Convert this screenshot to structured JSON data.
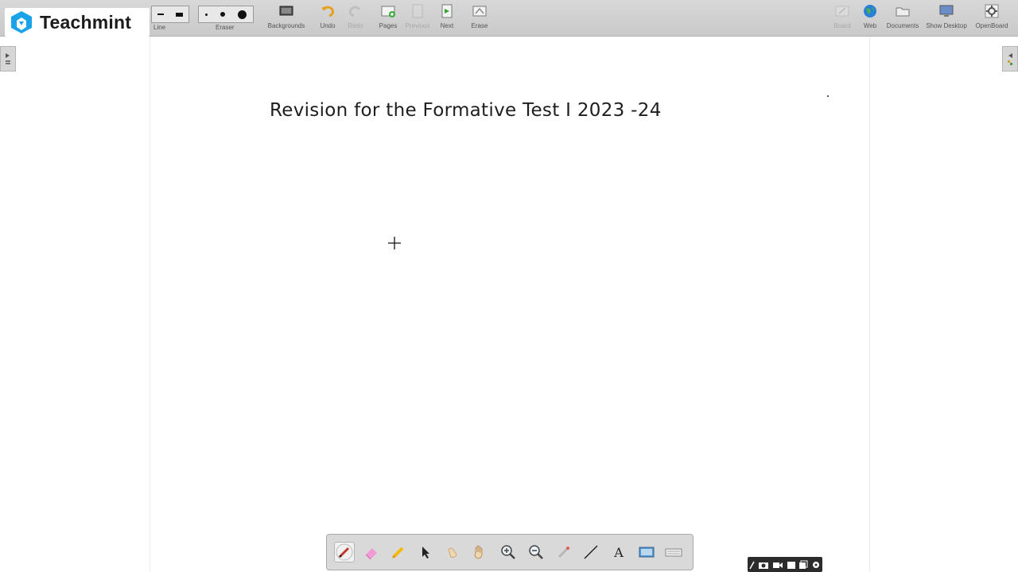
{
  "app": {
    "logo_text": "Teachmint"
  },
  "toolbar": {
    "line_label": "Line",
    "eraser_label": "Eraser",
    "buttons": [
      {
        "label": "Backgrounds",
        "icon": "backgrounds-icon",
        "enabled": true
      },
      {
        "label": "Undo",
        "icon": "undo-icon",
        "enabled": true
      },
      {
        "label": "Redo",
        "icon": "redo-icon",
        "enabled": false
      },
      {
        "label": "Pages",
        "icon": "pages-icon",
        "enabled": true
      },
      {
        "label": "Previous",
        "icon": "previous-page-icon",
        "enabled": false
      },
      {
        "label": "Next",
        "icon": "next-page-icon",
        "enabled": true
      },
      {
        "label": "Erase",
        "icon": "erase-all-icon",
        "enabled": true
      }
    ],
    "right_buttons": [
      {
        "label": "Board",
        "icon": "board-icon",
        "enabled": false
      },
      {
        "label": "Web",
        "icon": "globe-icon",
        "enabled": true
      },
      {
        "label": "Documents",
        "icon": "folder-icon",
        "enabled": true
      },
      {
        "label": "Show Desktop",
        "icon": "desktop-icon",
        "enabled": true
      },
      {
        "label": "OpenBoard",
        "icon": "settings-icon",
        "enabled": true
      }
    ]
  },
  "page": {
    "title": "Revision for the Formative Test I 2023 -24"
  },
  "floating_toolbar": {
    "tools": [
      "pen-icon",
      "eraser-icon",
      "marker-icon",
      "selector-icon",
      "play-icon",
      "hand-icon",
      "zoom-in-icon",
      "zoom-out-icon",
      "laser-pointer-icon",
      "line-icon",
      "text-icon",
      "capture-icon",
      "keyboard-icon"
    ],
    "active_tool": "pen-icon",
    "text_tool_glyph": "A"
  },
  "colors": {
    "toolbar_bg": "#cfcfcf",
    "page_bg": "#ffffff",
    "logo_blue": "#1aa3e8"
  }
}
